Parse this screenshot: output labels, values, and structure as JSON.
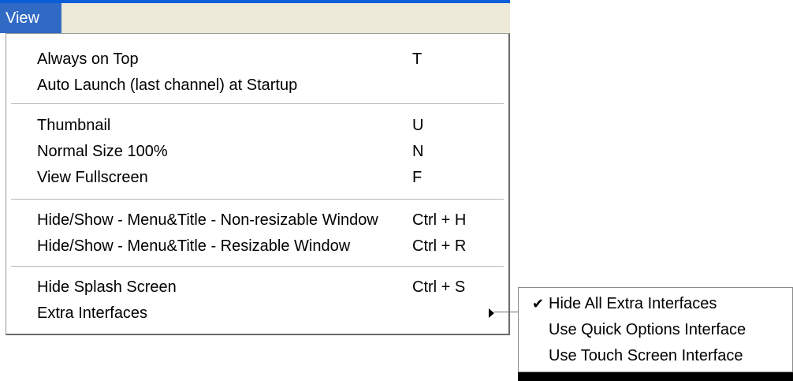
{
  "menubar": {
    "view_label": "View"
  },
  "menu": {
    "items": [
      {
        "label": "Always on Top",
        "shortcut": "T"
      },
      {
        "label": "Auto Launch (last channel) at Startup",
        "shortcut": ""
      },
      {
        "label": "Thumbnail",
        "shortcut": "U"
      },
      {
        "label": "Normal Size 100%",
        "shortcut": "N"
      },
      {
        "label": "View Fullscreen",
        "shortcut": "F"
      },
      {
        "label": "Hide/Show - Menu&Title - Non-resizable Window",
        "shortcut": "Ctrl + H"
      },
      {
        "label": "Hide/Show - Menu&Title - Resizable Window",
        "shortcut": "Ctrl + R"
      },
      {
        "label": "Hide Splash Screen",
        "shortcut": "Ctrl + S"
      },
      {
        "label": "Extra Interfaces",
        "shortcut": ""
      }
    ]
  },
  "submenu": {
    "items": [
      {
        "label": "Hide All Extra Interfaces",
        "checked": true,
        "check_glyph": "✔"
      },
      {
        "label": "Use Quick Options Interface",
        "checked": false
      },
      {
        "label": "Use Touch Screen Interface",
        "checked": false
      }
    ]
  },
  "colors": {
    "selection": "#316ac5",
    "menubar_bg": "#ece9d8",
    "title_accent": "#0a5fd8"
  }
}
